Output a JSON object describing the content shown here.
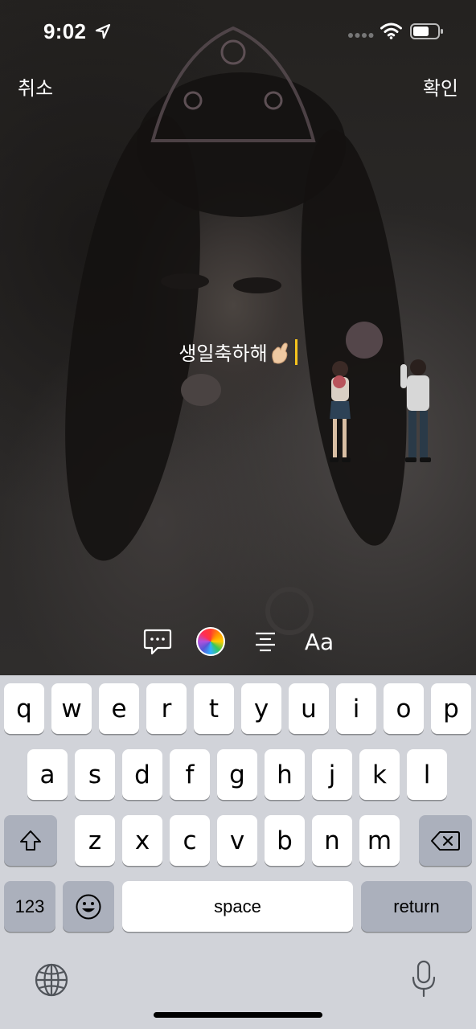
{
  "status_bar": {
    "time": "9:02",
    "icons": [
      "location-arrow-icon",
      "cellular-signal-icon",
      "wifi-icon",
      "battery-icon"
    ]
  },
  "header": {
    "cancel_label": "취소",
    "confirm_label": "확인"
  },
  "caption": {
    "text": "생일축하해",
    "emoji": "finger-heart-emoji"
  },
  "toolbar": {
    "tools": [
      "speech-bubble-icon",
      "color-wheel-icon",
      "align-center-icon"
    ],
    "font_label": "Aa"
  },
  "keyboard": {
    "row1": [
      "q",
      "w",
      "e",
      "r",
      "t",
      "y",
      "u",
      "i",
      "o",
      "p"
    ],
    "row2": [
      "a",
      "s",
      "d",
      "f",
      "g",
      "h",
      "j",
      "k",
      "l"
    ],
    "row3": [
      "z",
      "x",
      "c",
      "v",
      "b",
      "n",
      "m"
    ],
    "shift_icon": "shift-icon",
    "delete_icon": "backspace-icon",
    "numbers_label": "123",
    "emoji_icon": "emoji-icon",
    "space_label": "space",
    "return_label": "return",
    "globe_icon": "globe-icon",
    "mic_icon": "microphone-icon"
  },
  "colors": {
    "cursor": "#f5c31d",
    "keyboard_bg": "#d1d3d9",
    "key_light": "#ffffff",
    "key_dark": "#abb0bc"
  }
}
